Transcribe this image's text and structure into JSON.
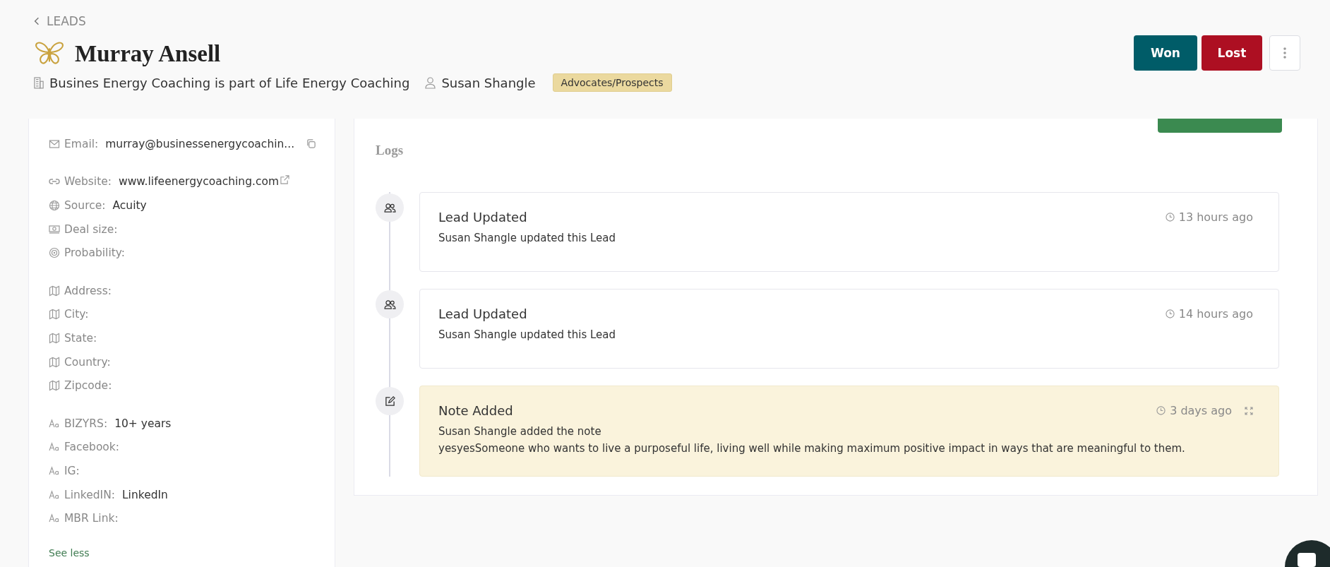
{
  "breadcrumb": {
    "label": "LEADS"
  },
  "lead": {
    "name": "Murray Ansell",
    "company": "Busines Energy Coaching is part of Life Energy Coaching",
    "owner": "Susan Shangle",
    "tag": "Advocates/Prospects"
  },
  "actions": [
    {
      "label": "Won",
      "kind": "won"
    },
    {
      "label": "Lost",
      "kind": "lost"
    }
  ],
  "details": {
    "groups": [
      [
        {
          "kind": "mail",
          "label": "Email:",
          "value": "murray@businessenergycoachin...",
          "copyable": true
        }
      ],
      [
        {
          "kind": "link",
          "label": "Website:",
          "value": "www.lifeenergycoaching.com",
          "external": true
        },
        {
          "kind": "globe",
          "label": "Source:",
          "value": "Acuity"
        },
        {
          "kind": "money",
          "label": "Deal size:"
        },
        {
          "kind": "target",
          "label": "Probability:"
        }
      ],
      [
        {
          "kind": "map",
          "label": "Address:"
        },
        {
          "kind": "map",
          "label": "City:"
        },
        {
          "kind": "map",
          "label": "State:"
        },
        {
          "kind": "map",
          "label": "Country:"
        },
        {
          "kind": "map",
          "label": "Zipcode:"
        }
      ],
      [
        {
          "kind": "text",
          "label": "BIZYRS:",
          "value": "10+ years"
        },
        {
          "kind": "text",
          "label": "Facebook:"
        },
        {
          "kind": "text",
          "label": "IG:"
        },
        {
          "kind": "text",
          "label": "LinkedIN:",
          "value": "LinkedIn"
        },
        {
          "kind": "text",
          "label": "MBR Link:"
        }
      ]
    ],
    "toggle": "See less"
  },
  "logs": {
    "title": "Logs",
    "items": [
      {
        "kind": "update",
        "title": "Lead Updated",
        "subtitle": "Susan Shangle updated this Lead",
        "time": "13 hours ago"
      },
      {
        "kind": "update",
        "title": "Lead Updated",
        "subtitle": "Susan Shangle updated this Lead",
        "time": "14 hours ago"
      },
      {
        "kind": "note",
        "title": "Note Added",
        "subtitle": "Susan Shangle added the note",
        "body": "yesyesSomeone who wants to live a purposeful life, living well while making maximum positive impact in ways that are meaningful to them.",
        "time": "3 days ago",
        "expandable": true
      }
    ]
  }
}
